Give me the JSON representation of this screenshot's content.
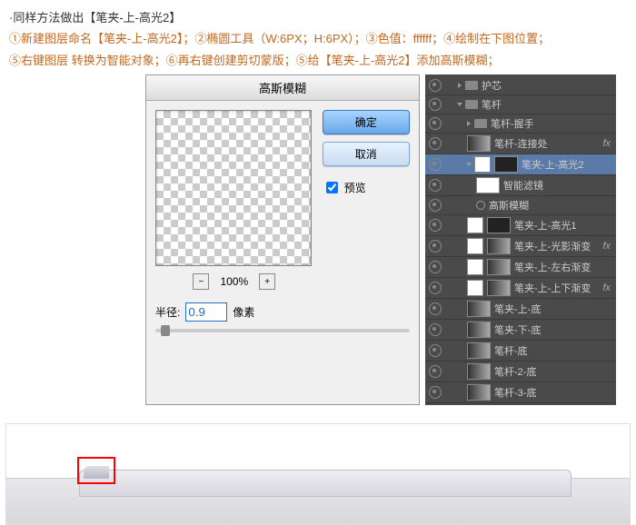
{
  "instructions": {
    "line0": "·同样方法做出【笔夹-上-高光2】",
    "line1": "①新建图层命名【笔夹-上-高光2】；②椭圆工具（W:6PX；H:6PX）；③色值：ffffff；④绘制在下图位置；",
    "line2": "⑤右键图层 转换为智能对象；⑥再右键创建剪切蒙版；⑤给【笔夹-上-高光2】添加高斯模糊；"
  },
  "dialog": {
    "title": "高斯模糊",
    "zoom": "100%",
    "radius_label": "半径:",
    "radius_value": "0.9",
    "radius_unit": "像素",
    "ok": "确定",
    "cancel": "取消",
    "preview": "预览"
  },
  "layers": {
    "items": [
      {
        "name": "护芯",
        "type": "folder",
        "indent": 1
      },
      {
        "name": "笔杆",
        "type": "folder",
        "indent": 1,
        "open": true
      },
      {
        "name": "笔杆-握手",
        "type": "folder",
        "indent": 2
      },
      {
        "name": "笔杆-连接处",
        "type": "layer",
        "indent": 2,
        "fx": true,
        "grad": true
      },
      {
        "name": "笔夹-上-高光2",
        "type": "layer",
        "indent": 2,
        "sel": true,
        "open": true,
        "mask": true
      },
      {
        "name": "智能滤镜",
        "type": "sub",
        "indent": 3,
        "white": true
      },
      {
        "name": "高斯模糊",
        "type": "sub",
        "indent": 3
      },
      {
        "name": "笔夹-上-高光1",
        "type": "layer",
        "indent": 2,
        "mask": true
      },
      {
        "name": "笔夹-上-光影渐变",
        "type": "layer",
        "indent": 2,
        "fx": true,
        "mask": true,
        "grad": true
      },
      {
        "name": "笔夹-上-左右渐变",
        "type": "layer",
        "indent": 2,
        "mask": true,
        "grad": true
      },
      {
        "name": "笔夹-上-上下渐变",
        "type": "layer",
        "indent": 2,
        "fx": true,
        "mask": true,
        "grad": true
      },
      {
        "name": "笔夹-上-底",
        "type": "layer",
        "indent": 2,
        "grad": true
      },
      {
        "name": "笔夹-下-底",
        "type": "layer",
        "indent": 2,
        "grad": true
      },
      {
        "name": "笔杆-底",
        "type": "layer",
        "indent": 2,
        "grad": true
      },
      {
        "name": "笔杆-2-底",
        "type": "layer",
        "indent": 2,
        "grad": true
      },
      {
        "name": "笔杆-3-底",
        "type": "layer",
        "indent": 2,
        "grad": true
      }
    ]
  }
}
